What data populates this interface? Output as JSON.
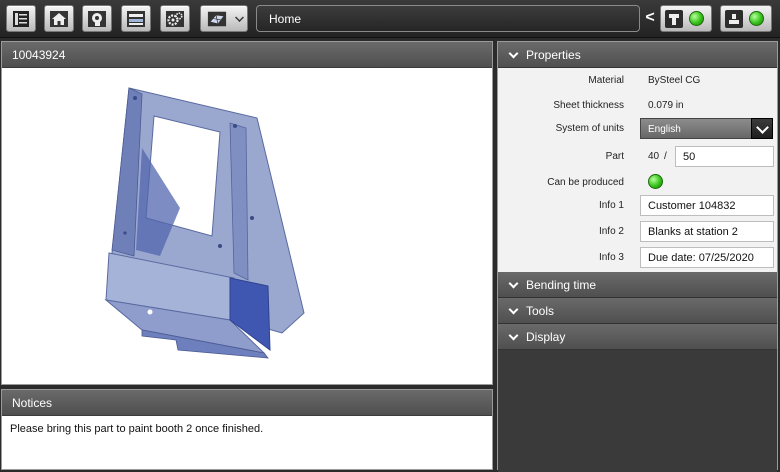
{
  "toolbar": {
    "location": "Home",
    "back": "<",
    "icons": [
      "job-list-icon",
      "home-icon",
      "head-gear-icon",
      "tray-icon",
      "gears-icon",
      "parts-grid-icon"
    ]
  },
  "viewer": {
    "title": "10043924"
  },
  "notices": {
    "title": "Notices",
    "text": "Please bring this part to paint booth 2 once finished."
  },
  "properties": {
    "title": "Properties",
    "material_label": "Material",
    "material": "BySteel CG",
    "thickness_label": "Sheet thickness",
    "thickness": "0.079 in",
    "units_label": "System of units",
    "units": "English",
    "part_label": "Part",
    "part_current": "40",
    "part_sep": "/",
    "part_total": "50",
    "produced_label": "Can be produced",
    "info1_label": "Info 1",
    "info1": "Customer 104832",
    "info2_label": "Info 2",
    "info2": "Blanks at station 2",
    "info3_label": "Info 3",
    "info3": "Due date: 07/25/2020"
  },
  "sections": {
    "bending": "Bending time",
    "tools": "Tools",
    "display": "Display"
  },
  "colors": {
    "status_ok": "#36c21a",
    "part_metal": "#8a9ac8"
  }
}
